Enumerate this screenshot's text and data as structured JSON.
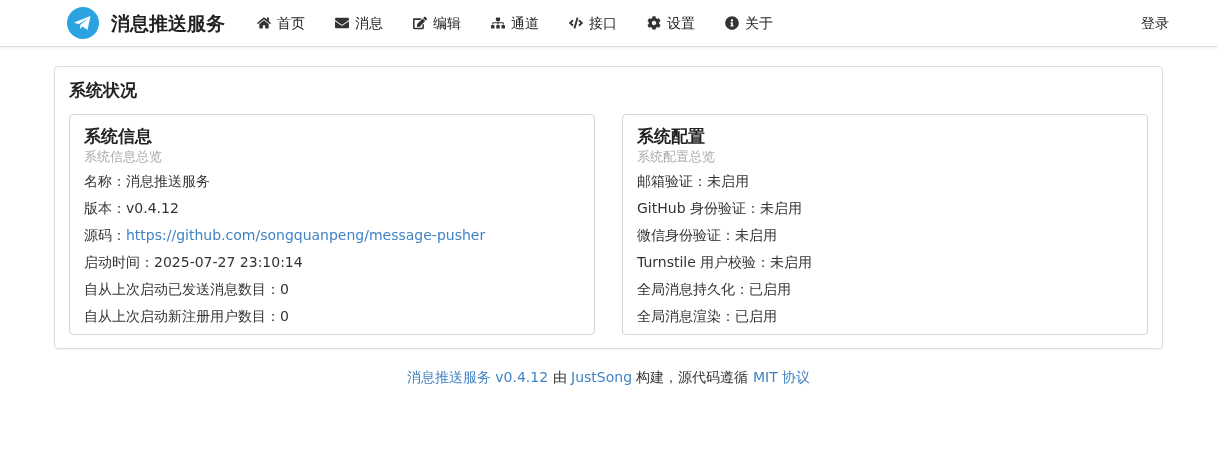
{
  "header": {
    "brand": "消息推送服务",
    "nav": [
      {
        "label": "首页"
      },
      {
        "label": "消息"
      },
      {
        "label": "编辑"
      },
      {
        "label": "通道"
      },
      {
        "label": "接口"
      },
      {
        "label": "设置"
      },
      {
        "label": "关于"
      }
    ],
    "login": "登录"
  },
  "panel": {
    "title": "系统状况",
    "cards": [
      {
        "title": "系统信息",
        "subtitle": "系统信息总览",
        "rows": [
          {
            "kind": "text",
            "label": "名称：",
            "value": "消息推送服务"
          },
          {
            "kind": "text",
            "label": "版本：",
            "value": "v0.4.12"
          },
          {
            "kind": "link",
            "label": "源码：",
            "value": "https://github.com/songquanpeng/message-pusher"
          },
          {
            "kind": "text",
            "label": "启动时间：",
            "value": "2025-07-27 23:10:14"
          },
          {
            "kind": "text",
            "label": "自从上次启动已发送消息数目：",
            "value": "0"
          },
          {
            "kind": "text",
            "label": "自从上次启动新注册用户数目：",
            "value": "0"
          }
        ]
      },
      {
        "title": "系统配置",
        "subtitle": "系统配置总览",
        "rows": [
          {
            "kind": "text",
            "label": "邮箱验证：",
            "value": "未启用"
          },
          {
            "kind": "text",
            "label": "GitHub 身份验证：",
            "value": "未启用"
          },
          {
            "kind": "text",
            "label": "微信身份验证：",
            "value": "未启用"
          },
          {
            "kind": "text",
            "label": "Turnstile 用户校验：",
            "value": "未启用"
          },
          {
            "kind": "text",
            "label": "全局消息持久化：",
            "value": "已启用"
          },
          {
            "kind": "text",
            "label": "全局消息渲染：",
            "value": "已启用"
          }
        ]
      }
    ]
  },
  "footer": [
    {
      "text": "消息推送服务 v0.4.12",
      "link": true
    },
    {
      "text": " 由 ",
      "link": false
    },
    {
      "text": "JustSong",
      "link": true
    },
    {
      "text": " 构建，源代码遵循 ",
      "link": false
    },
    {
      "text": "MIT 协议",
      "link": true
    }
  ]
}
